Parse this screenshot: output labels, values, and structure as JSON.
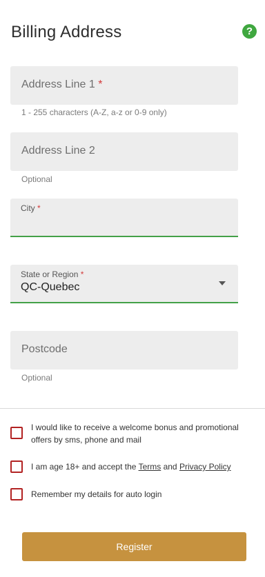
{
  "header": {
    "title": "Billing Address",
    "help_icon": "?"
  },
  "fields": {
    "address1": {
      "placeholder": "Address Line 1",
      "required_mark": "*",
      "hint": "1 - 255 characters (A-Z, a-z or 0-9 only)"
    },
    "address2": {
      "placeholder": "Address Line 2",
      "hint": "Optional"
    },
    "city": {
      "label": "City",
      "required_mark": "*",
      "value": ""
    },
    "state": {
      "label": "State or Region",
      "required_mark": "*",
      "value": "QC-Quebec"
    },
    "postcode": {
      "placeholder": "Postcode",
      "hint": "Optional"
    }
  },
  "checkboxes": {
    "promo": {
      "label": "I would like to receive a welcome bonus and promotional offers by sms, phone and mail"
    },
    "age": {
      "prefix": "I am age 18+ and accept the ",
      "terms_link": "Terms",
      "and": " and ",
      "privacy_link": "Privacy Policy"
    },
    "remember": {
      "label": "Remember my details for auto login"
    }
  },
  "register_button": {
    "label": "Register"
  },
  "colors": {
    "accent_green": "#43a047",
    "button_gold": "#c6923f",
    "checkbox_red": "#b22222",
    "required_red": "#d23a3a"
  }
}
